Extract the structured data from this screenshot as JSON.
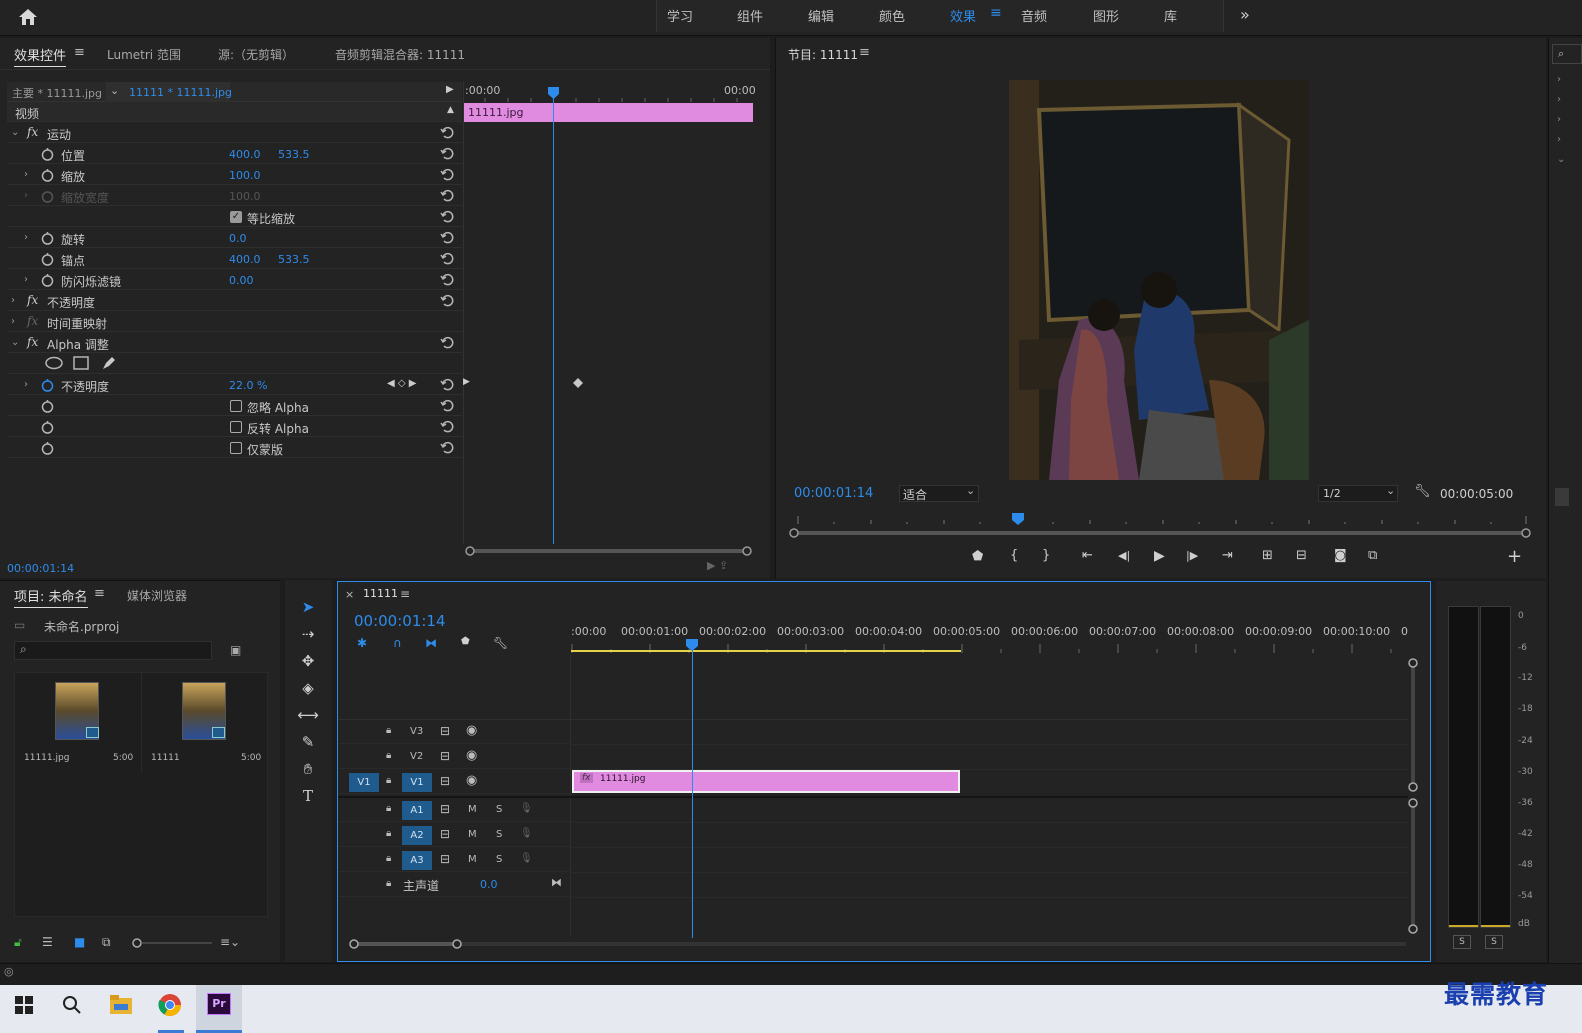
{
  "topbar": {
    "workspaces": [
      "学习",
      "组件",
      "编辑",
      "颜色",
      "效果",
      "音频",
      "图形",
      "库"
    ],
    "active": "效果"
  },
  "effects_panel": {
    "tabs": [
      "效果控件",
      "Lumetri 范围",
      "源:（无剪辑）",
      "音频剪辑混合器: 11111"
    ],
    "master_label": "主要 * 11111.jpg",
    "seq_label": "11111 * 11111.jpg",
    "ruler_start": ":00:00",
    "ruler_end": "00:00",
    "clip_label": "11111.jpg",
    "video_header": "视频",
    "motion": "运动",
    "props": {
      "position": {
        "label": "位置",
        "x": "400.0",
        "y": "533.5"
      },
      "scale": {
        "label": "缩放",
        "v": "100.0"
      },
      "scale_w": {
        "label": "缩放宽度",
        "v": "100.0"
      },
      "uniform": {
        "label": "等比缩放"
      },
      "rotation": {
        "label": "旋转",
        "v": "0.0"
      },
      "anchor": {
        "label": "锚点",
        "x": "400.0",
        "y": "533.5"
      },
      "flicker": {
        "label": "防闪烁滤镜",
        "v": "0.00"
      }
    },
    "opacity": "不透明度",
    "timeremap": "时间重映射",
    "alpha_fx": "Alpha 调整",
    "alpha_opacity": {
      "label": "不透明度",
      "v": "22.0 %"
    },
    "ignore_alpha": "忽略 Alpha",
    "invert_alpha": "反转 Alpha",
    "mask_only": "仅蒙版",
    "timecode": "00:00:01:14"
  },
  "program": {
    "title": "节目: 11111",
    "timecode": "00:00:01:14",
    "fit": "适合",
    "res": "1/2",
    "duration": "00:00:05:00"
  },
  "project": {
    "tabs": [
      "项目: 未命名",
      "媒体浏览器"
    ],
    "file": "未命名.prproj",
    "items": [
      {
        "name": "11111.jpg",
        "dur": "5:00"
      },
      {
        "name": "11111",
        "dur": "5:00"
      }
    ]
  },
  "timeline": {
    "tab": "11111",
    "timecode": "00:00:01:14",
    "ruler": [
      ":00:00",
      "00:00:01:00",
      "00:00:02:00",
      "00:00:03:00",
      "00:00:04:00",
      "00:00:05:00",
      "00:00:06:00",
      "00:00:07:00",
      "00:00:08:00",
      "00:00:09:00",
      "00:00:10:00",
      "0"
    ],
    "video_tracks": [
      "V3",
      "V2",
      "V1"
    ],
    "src_v": "V1",
    "audio_tracks": [
      "A1",
      "A2",
      "A3"
    ],
    "m": "M",
    "s": "S",
    "master": "主声道",
    "master_val": "0.0",
    "clip": "11111.jpg"
  },
  "meter": {
    "labels": [
      "0",
      "-6",
      "-12",
      "-18",
      "-24",
      "-30",
      "-36",
      "-42",
      "-48",
      "-54",
      "dB"
    ],
    "s": "S"
  },
  "watermark": "最需教育",
  "colors": {
    "accent": "#2d8ceb",
    "clip": "#e08ae0"
  }
}
